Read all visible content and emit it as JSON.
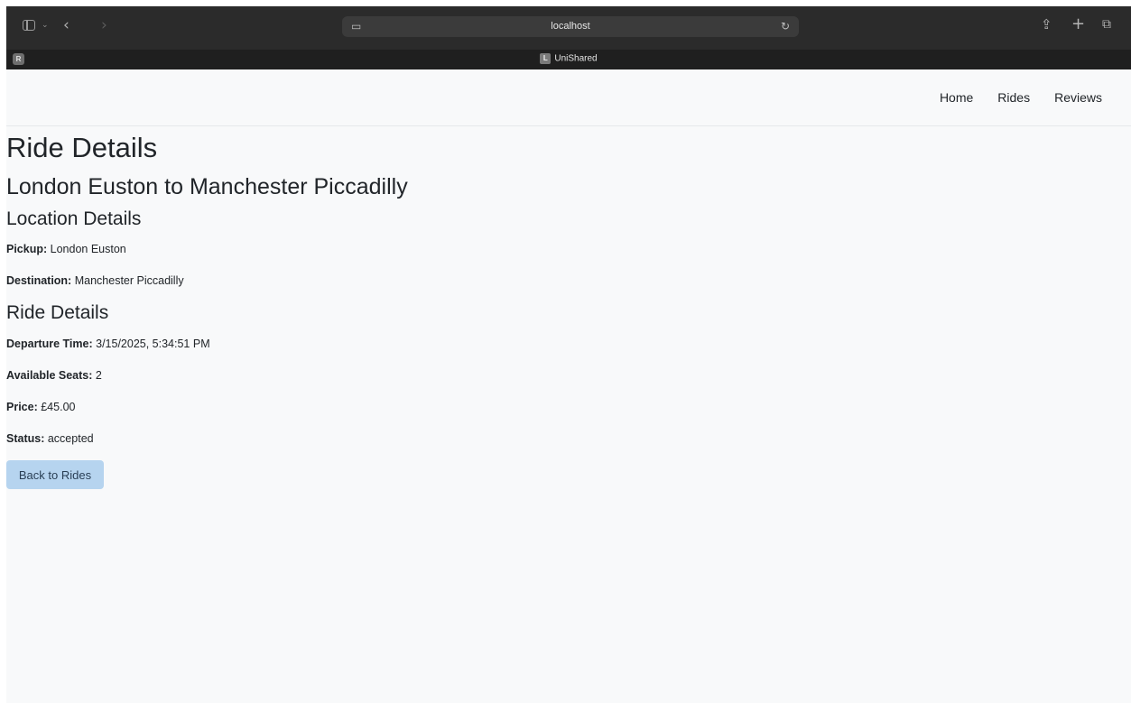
{
  "browser": {
    "address": "localhost",
    "tab_title": "UniShared",
    "tab_favicon_letter": "L",
    "pinned_tab_letter": "R",
    "icons": {
      "sidebar": "sidebar-toggle-icon",
      "chevron": "chevron-down-icon",
      "back": "back-arrow-icon",
      "forward": "forward-arrow-icon",
      "reader": "reader-icon",
      "reload": "reload-icon",
      "share": "share-icon",
      "new_tab": "plus-icon",
      "tabs_overview": "tabs-overview-icon"
    }
  },
  "nav": {
    "home": "Home",
    "rides": "Rides",
    "reviews": "Reviews"
  },
  "page": {
    "title": "Ride Details",
    "route": "London Euston to Manchester Piccadilly",
    "location_heading": "Location Details",
    "pickup_label": "Pickup:",
    "pickup_value": "London Euston",
    "destination_label": "Destination:",
    "destination_value": "Manchester Piccadilly",
    "ride_heading": "Ride Details",
    "departure_label": "Departure Time:",
    "departure_value": "3/15/2025, 5:34:51 PM",
    "seats_label": "Available Seats:",
    "seats_value": "2",
    "price_label": "Price:",
    "price_value": "£45.00",
    "status_label": "Status:",
    "status_value": "accepted",
    "back_button": "Back to Rides"
  },
  "colors": {
    "page_bg": "#f8f9fa",
    "text": "#212529",
    "button_bg": "#b6d4ef",
    "toolbar_bg": "#2b2b2b"
  }
}
